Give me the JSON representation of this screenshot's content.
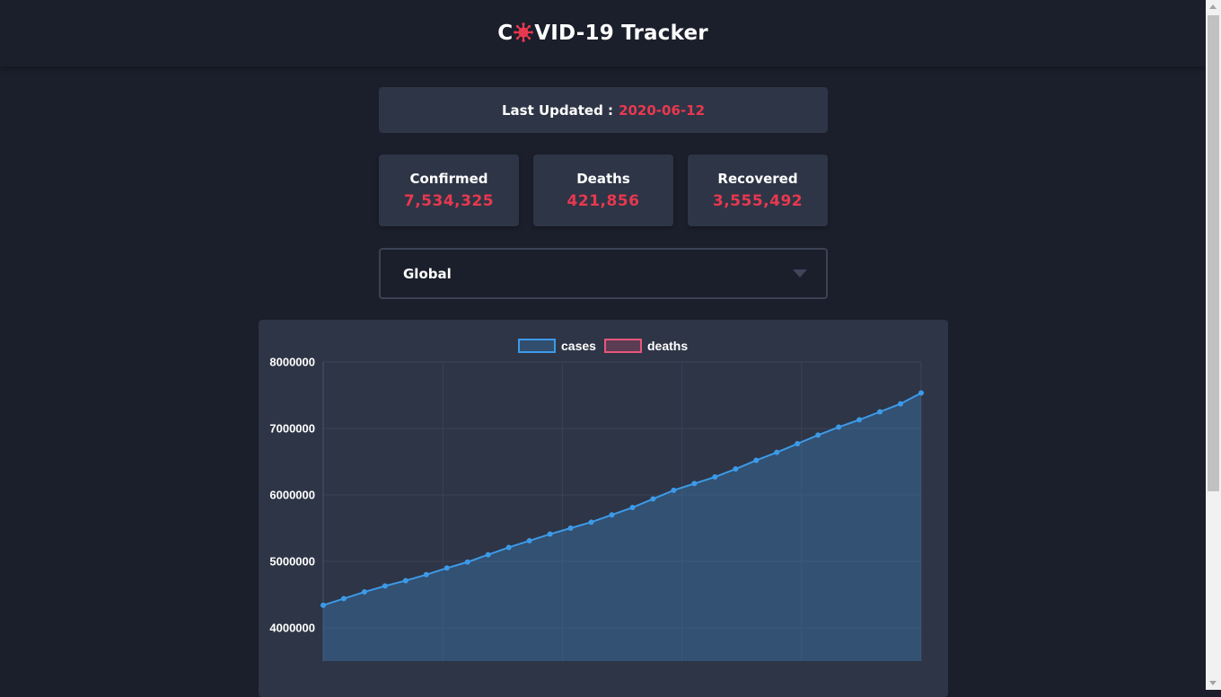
{
  "header": {
    "title_prefix": "C",
    "title_suffix": "VID-19 Tracker",
    "logo_icon": "virus-icon",
    "logo_color": "#e8384f"
  },
  "last_updated": {
    "label": "Last Updated :",
    "date": "2020-06-12"
  },
  "stats": [
    {
      "label": "Confirmed",
      "value": "7,534,325"
    },
    {
      "label": "Deaths",
      "value": "421,856"
    },
    {
      "label": "Recovered",
      "value": "3,555,492"
    }
  ],
  "region_select": {
    "selected": "Global",
    "icon": "chevron-down-icon"
  },
  "colors": {
    "background": "#1b1f2b",
    "card": "#2e3546",
    "accent": "#e8384f",
    "cases_line": "#3c9ae8",
    "deaths_line": "#e8557a"
  },
  "chart_data": {
    "type": "area",
    "series": [
      {
        "name": "cases",
        "color": "#3c9ae8",
        "values": [
          4340000,
          4440000,
          4540000,
          4630000,
          4710000,
          4800000,
          4900000,
          4990000,
          5100000,
          5210000,
          5310000,
          5410000,
          5500000,
          5590000,
          5700000,
          5810000,
          5940000,
          6070000,
          6170000,
          6270000,
          6390000,
          6520000,
          6640000,
          6770000,
          6900000,
          7020000,
          7130000,
          7250000,
          7370000,
          7534325
        ]
      },
      {
        "name": "deaths",
        "color": "#e8557a",
        "values": []
      }
    ],
    "ylim": [
      3500000,
      8000000
    ],
    "y_ticks": [
      "8000000",
      "7000000",
      "6000000",
      "5000000",
      "4000000"
    ],
    "y_tick_values": [
      8000000,
      7000000,
      6000000,
      5000000,
      4000000
    ],
    "grid": true,
    "legend": "top-center"
  }
}
